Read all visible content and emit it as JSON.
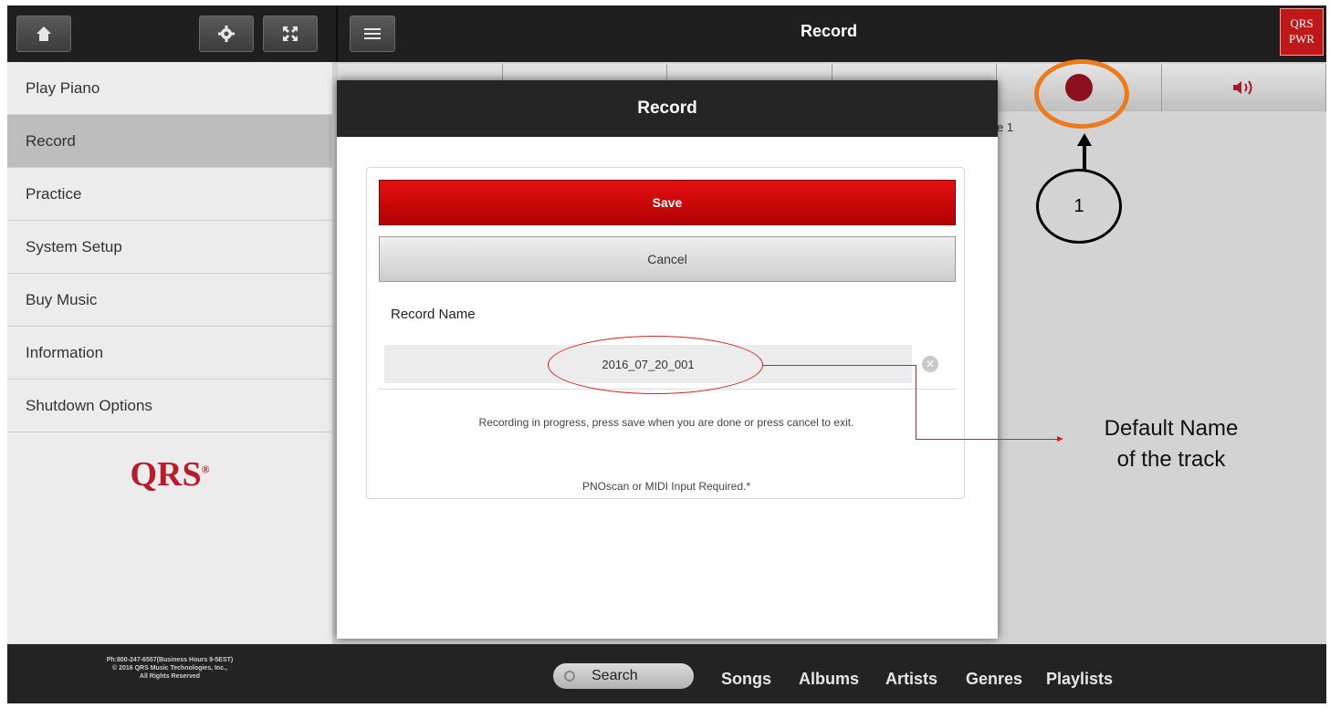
{
  "topbar": {
    "title": "Record",
    "brand_badge": [
      "QRS",
      "PWR"
    ],
    "icons": [
      "home-icon",
      "gear-icon",
      "fullscreen-icon",
      "menu-icon"
    ]
  },
  "sidebar": {
    "items": [
      {
        "label": "Play Piano"
      },
      {
        "label": "Record"
      },
      {
        "label": "Practice"
      },
      {
        "label": "System Setup"
      },
      {
        "label": "Buy Music"
      },
      {
        "label": "Information"
      },
      {
        "label": "Shutdown Options"
      }
    ],
    "active_index": 1,
    "logo_text": "QRS"
  },
  "player": {
    "partial_text": "e 1",
    "icons": [
      "record-icon",
      "speaker-icon"
    ]
  },
  "modal": {
    "title": "Record",
    "save_label": "Save",
    "cancel_label": "Cancel",
    "field_label": "Record Name",
    "record_name": "2016_07_20_001",
    "status_message": "Recording in progress, press save when you are done or press cancel to exit.",
    "requirement_note": "PNOscan or MIDI Input Required.*"
  },
  "footer": {
    "contact_lines": [
      "Ph:800-247-6557(Business Hours 9-5EST)",
      "© 2016 QRS Music Technologies, Inc.,",
      "All Rights Reserved"
    ],
    "search_label": "Search",
    "nav": [
      "Songs",
      "Albums",
      "Artists",
      "Genres",
      "Playlists"
    ]
  },
  "annotations": {
    "step_number": "1",
    "caption_line1": "Default Name",
    "caption_line2": "of the track"
  },
  "colors": {
    "accent_red": "#c01818",
    "annotation_orange": "#ef7a1a",
    "annotation_red": "#d42020"
  }
}
